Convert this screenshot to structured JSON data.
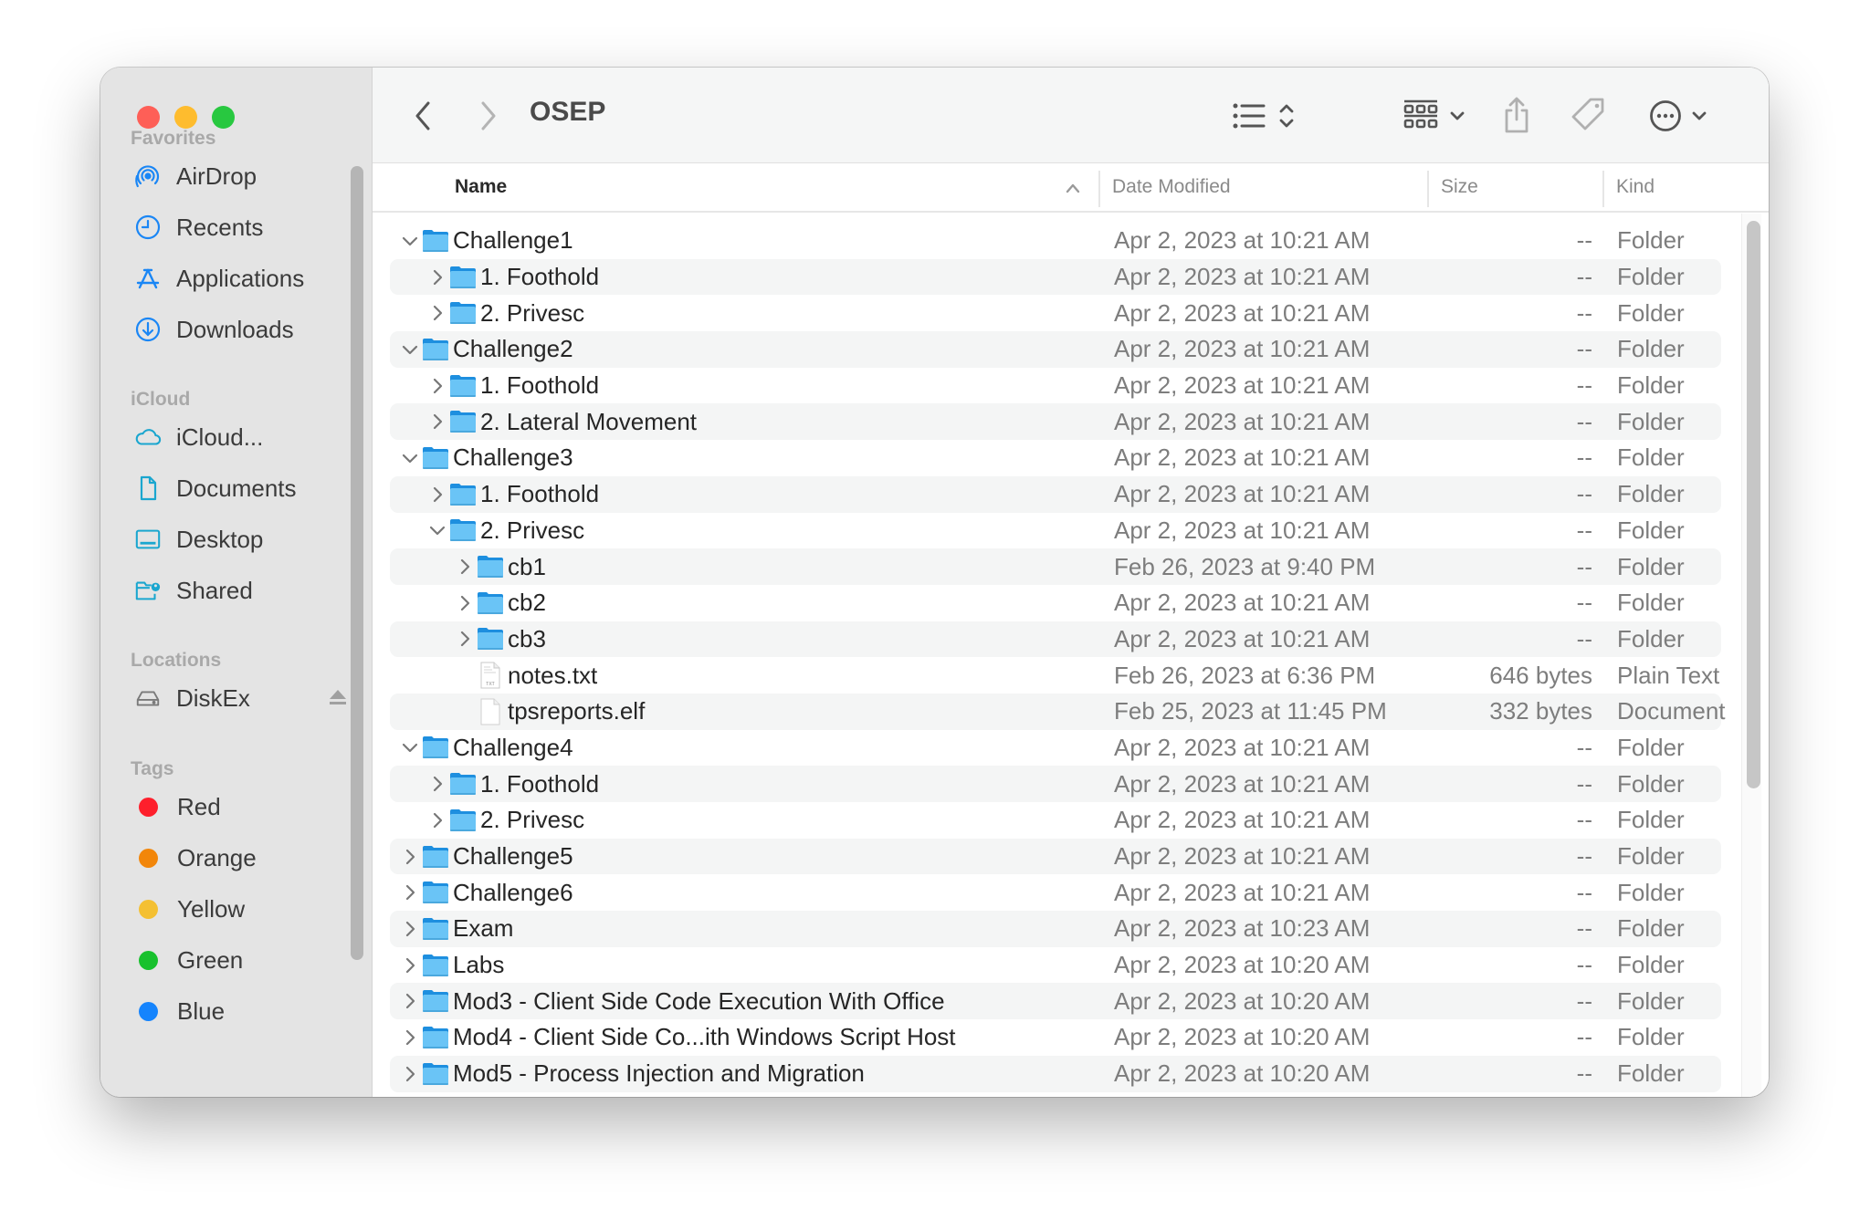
{
  "window": {
    "traffic_lights": [
      "close",
      "minimize",
      "zoom"
    ]
  },
  "sidebar": {
    "sections": [
      {
        "title": "Favorites",
        "items": [
          {
            "label": "AirDrop",
            "icon": "airdrop-icon"
          },
          {
            "label": "Recents",
            "icon": "clock-icon"
          },
          {
            "label": "Applications",
            "icon": "applications-icon"
          },
          {
            "label": "Downloads",
            "icon": "download-icon"
          }
        ]
      },
      {
        "title": "iCloud",
        "items": [
          {
            "label": "iCloud...",
            "icon": "cloud-icon"
          },
          {
            "label": "Documents",
            "icon": "document-icon"
          },
          {
            "label": "Desktop",
            "icon": "desktop-icon"
          },
          {
            "label": "Shared",
            "icon": "shared-folder-icon"
          }
        ]
      },
      {
        "title": "Locations",
        "items": [
          {
            "label": "DiskEx",
            "icon": "disk-icon",
            "eject": true
          }
        ]
      },
      {
        "title": "Tags",
        "items": [
          {
            "label": "Red",
            "color": "#fe1f2c"
          },
          {
            "label": "Orange",
            "color": "#f2860a"
          },
          {
            "label": "Yellow",
            "color": "#f4c032"
          },
          {
            "label": "Green",
            "color": "#18c12d"
          },
          {
            "label": "Blue",
            "color": "#1584fd"
          }
        ]
      }
    ]
  },
  "toolbar": {
    "title": "OSEP",
    "back_icon": "chevron-left-icon",
    "forward_icon": "chevron-right-icon",
    "view_icon": "list-view-icon",
    "group_icon": "group-grid-icon",
    "share_icon": "share-icon",
    "tag_icon": "tag-icon",
    "more_icon": "ellipsis-circle-icon",
    "search_icon": "search-icon"
  },
  "columns": {
    "name": "Name",
    "date": "Date Modified",
    "size": "Size",
    "kind": "Kind",
    "sort": "ascending"
  },
  "rows": [
    {
      "name": "Challenge1",
      "level": 0,
      "type": "folder",
      "expanded": true,
      "date": "Apr 2, 2023 at 10:21 AM",
      "size": "--",
      "kind": "Folder"
    },
    {
      "name": "1. Foothold",
      "level": 1,
      "type": "folder",
      "expanded": false,
      "date": "Apr 2, 2023 at 10:21 AM",
      "size": "--",
      "kind": "Folder"
    },
    {
      "name": "2. Privesc",
      "level": 1,
      "type": "folder",
      "expanded": false,
      "date": "Apr 2, 2023 at 10:21 AM",
      "size": "--",
      "kind": "Folder"
    },
    {
      "name": "Challenge2",
      "level": 0,
      "type": "folder",
      "expanded": true,
      "date": "Apr 2, 2023 at 10:21 AM",
      "size": "--",
      "kind": "Folder"
    },
    {
      "name": "1. Foothold",
      "level": 1,
      "type": "folder",
      "expanded": false,
      "date": "Apr 2, 2023 at 10:21 AM",
      "size": "--",
      "kind": "Folder"
    },
    {
      "name": "2. Lateral Movement",
      "level": 1,
      "type": "folder",
      "expanded": false,
      "date": "Apr 2, 2023 at 10:21 AM",
      "size": "--",
      "kind": "Folder"
    },
    {
      "name": "Challenge3",
      "level": 0,
      "type": "folder",
      "expanded": true,
      "date": "Apr 2, 2023 at 10:21 AM",
      "size": "--",
      "kind": "Folder"
    },
    {
      "name": "1. Foothold",
      "level": 1,
      "type": "folder",
      "expanded": false,
      "date": "Apr 2, 2023 at 10:21 AM",
      "size": "--",
      "kind": "Folder"
    },
    {
      "name": "2. Privesc",
      "level": 1,
      "type": "folder",
      "expanded": true,
      "date": "Apr 2, 2023 at 10:21 AM",
      "size": "--",
      "kind": "Folder"
    },
    {
      "name": "cb1",
      "level": 2,
      "type": "folder",
      "expanded": false,
      "date": "Feb 26, 2023 at 9:40 PM",
      "size": "--",
      "kind": "Folder"
    },
    {
      "name": "cb2",
      "level": 2,
      "type": "folder",
      "expanded": false,
      "date": "Apr 2, 2023 at 10:21 AM",
      "size": "--",
      "kind": "Folder"
    },
    {
      "name": "cb3",
      "level": 2,
      "type": "folder",
      "expanded": false,
      "date": "Apr 2, 2023 at 10:21 AM",
      "size": "--",
      "kind": "Folder"
    },
    {
      "name": "notes.txt",
      "level": 2,
      "type": "text",
      "date": "Feb 26, 2023 at 6:36 PM",
      "size": "646 bytes",
      "kind": "Plain Text"
    },
    {
      "name": "tpsreports.elf",
      "level": 2,
      "type": "document",
      "date": "Feb 25, 2023 at 11:45 PM",
      "size": "332 bytes",
      "kind": "Document"
    },
    {
      "name": "Challenge4",
      "level": 0,
      "type": "folder",
      "expanded": true,
      "date": "Apr 2, 2023 at 10:21 AM",
      "size": "--",
      "kind": "Folder"
    },
    {
      "name": "1. Foothold",
      "level": 1,
      "type": "folder",
      "expanded": false,
      "date": "Apr 2, 2023 at 10:21 AM",
      "size": "--",
      "kind": "Folder"
    },
    {
      "name": "2. Privesc",
      "level": 1,
      "type": "folder",
      "expanded": false,
      "date": "Apr 2, 2023 at 10:21 AM",
      "size": "--",
      "kind": "Folder"
    },
    {
      "name": "Challenge5",
      "level": 0,
      "type": "folder",
      "expanded": false,
      "date": "Apr 2, 2023 at 10:21 AM",
      "size": "--",
      "kind": "Folder"
    },
    {
      "name": "Challenge6",
      "level": 0,
      "type": "folder",
      "expanded": false,
      "date": "Apr 2, 2023 at 10:21 AM",
      "size": "--",
      "kind": "Folder"
    },
    {
      "name": "Exam",
      "level": 0,
      "type": "folder",
      "expanded": false,
      "date": "Apr 2, 2023 at 10:23 AM",
      "size": "--",
      "kind": "Folder"
    },
    {
      "name": "Labs",
      "level": 0,
      "type": "folder",
      "expanded": false,
      "date": "Apr 2, 2023 at 10:20 AM",
      "size": "--",
      "kind": "Folder"
    },
    {
      "name": "Mod3 - Client Side Code Execution With Office",
      "level": 0,
      "type": "folder",
      "expanded": false,
      "date": "Apr 2, 2023 at 10:20 AM",
      "size": "--",
      "kind": "Folder"
    },
    {
      "name": "Mod4 - Client Side Co...ith Windows Script Host",
      "level": 0,
      "type": "folder",
      "expanded": false,
      "date": "Apr 2, 2023 at 10:20 AM",
      "size": "--",
      "kind": "Folder"
    },
    {
      "name": "Mod5 - Process Injection and Migration",
      "level": 0,
      "type": "folder",
      "expanded": false,
      "date": "Apr 2, 2023 at 10:20 AM",
      "size": "--",
      "kind": "Folder"
    }
  ],
  "colors": {
    "folder_body": "#6ac4f6",
    "folder_tab": "#1e8fdf",
    "sidebar_icon": "#1a86f5",
    "icloud_icon": "#1aa6cf",
    "row_alt": "#f4f5f5"
  }
}
